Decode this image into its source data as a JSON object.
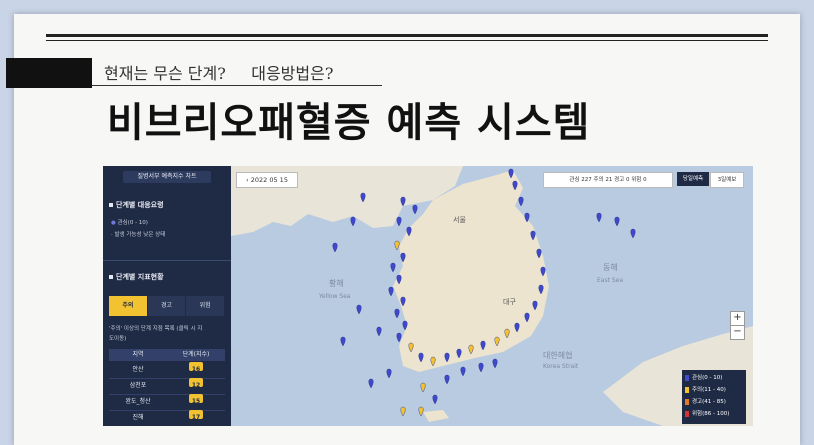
{
  "header": {
    "subtitle": "현재는 무슨 단계?     대응방법은?",
    "title": "비브리오패혈증 예측 시스템"
  },
  "sidebar": {
    "title": "질병서부 예측지수 차트",
    "section1": "단계별 대응요령",
    "level_label": "관심(0 - 10)",
    "level_desc": "발생 가능성 낮은 상태",
    "section2": "단계별 지표현황",
    "tabs": [
      "주의",
      "경고",
      "위험"
    ],
    "note1": "'주의' 이상의 단계 지점 목록 (클릭 시 지",
    "note2": "도이동)",
    "table_headers": [
      "지역",
      "단계(지수)"
    ],
    "rows": [
      {
        "region": "안산",
        "value": "16"
      },
      {
        "region": "삼천포",
        "value": "12"
      },
      {
        "region": "완도_청산",
        "value": "15"
      },
      {
        "region": "진해",
        "value": "17"
      }
    ]
  },
  "map": {
    "date": "2022 05 15",
    "summary": "관심 227   주의 21   경고 0   위험 0",
    "today_btn": "당일예측",
    "three_day_btn": "3일예보",
    "zoom_in": "+",
    "zoom_out": "−",
    "labels": [
      "황해",
      "Yellow Sea",
      "동해",
      "East Sea",
      "대한해협",
      "Korea Strait",
      "서울",
      "대구"
    ],
    "legend": [
      {
        "label": "관심(0 - 10)",
        "color": "#3f49c9"
      },
      {
        "label": "주의(11 - 40)",
        "color": "#f2c230"
      },
      {
        "label": "경고(41 - 85)",
        "color": "#e07a2a"
      },
      {
        "label": "위험(86 - 100)",
        "color": "#d23434"
      }
    ]
  }
}
